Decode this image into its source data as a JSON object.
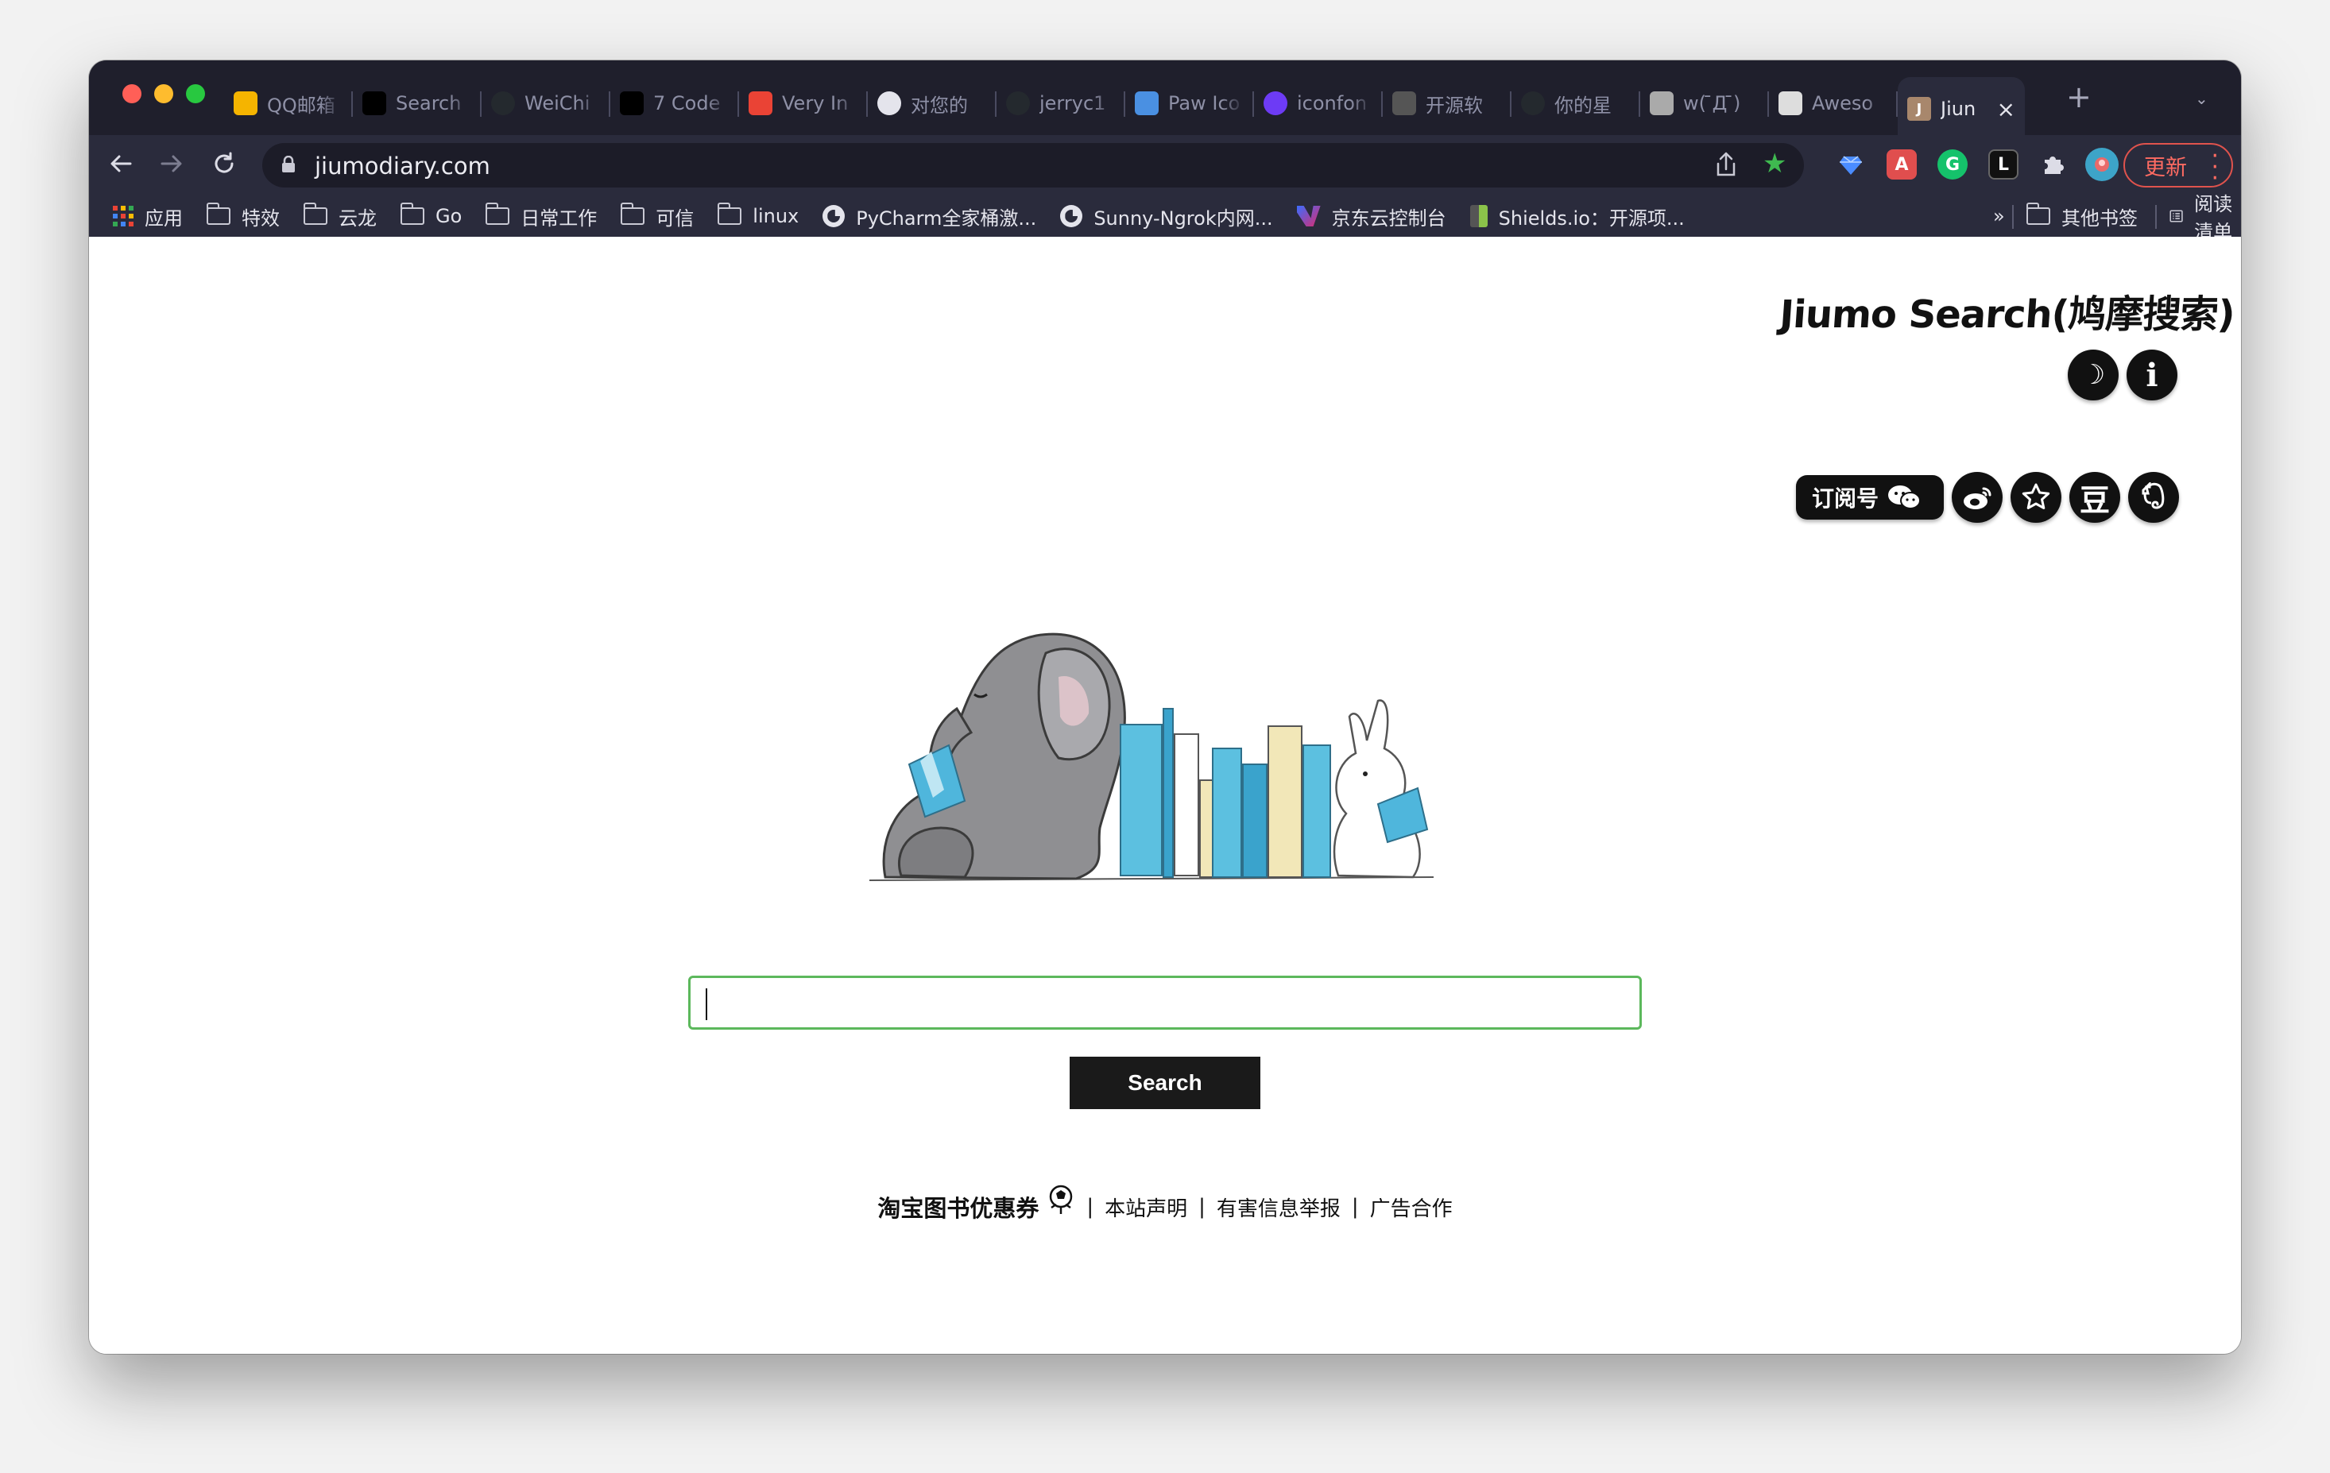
{
  "tabs": [
    {
      "label": "QQ邮箱",
      "icon": "qq-mail-icon",
      "color": "#f5b400"
    },
    {
      "label": "Search",
      "icon": "medium-icon",
      "color": "#000000"
    },
    {
      "label": "WeiChi",
      "icon": "github-icon",
      "color": "#24292e"
    },
    {
      "label": "7 Code",
      "icon": "medium-icon",
      "color": "#000000"
    },
    {
      "label": "Very In",
      "icon": "gmail-icon",
      "color": "#ea4335"
    },
    {
      "label": "对您的",
      "icon": "globe-icon",
      "color": "#e4e4ec"
    },
    {
      "label": "jerryc1",
      "icon": "github-icon",
      "color": "#24292e"
    },
    {
      "label": "Paw Ico",
      "icon": "flag-icon",
      "color": "#4a90e2"
    },
    {
      "label": "iconfon",
      "icon": "iconfont-icon",
      "color": "#6d3bf5"
    },
    {
      "label": "开源软",
      "icon": "oschina-icon",
      "color": "#555555"
    },
    {
      "label": "你的星",
      "icon": "github-icon",
      "color": "#24292e"
    },
    {
      "label": "w( ̄Д ̄)",
      "icon": "sun-icon",
      "color": "#aaaaaa"
    },
    {
      "label": "Aweso",
      "icon": "awesome-icon",
      "color": "#dddddd"
    },
    {
      "label": "Jiun",
      "icon": "jiumo-icon",
      "color": "#a8876c",
      "letter": "J"
    }
  ],
  "address": {
    "url": "jiumodiary.com"
  },
  "update_label": "更新",
  "bookmarks": [
    {
      "label": "应用",
      "icon": "apps-grid-icon"
    },
    {
      "label": "特效",
      "icon": "folder-icon"
    },
    {
      "label": "云龙",
      "icon": "folder-icon"
    },
    {
      "label": "Go",
      "icon": "folder-icon"
    },
    {
      "label": "日常工作",
      "icon": "folder-icon"
    },
    {
      "label": "可信",
      "icon": "folder-icon"
    },
    {
      "label": "linux",
      "icon": "folder-icon"
    },
    {
      "label": "PyCharm全家桶激...",
      "icon": "globe-icon"
    },
    {
      "label": "Sunny-Ngrok内网...",
      "icon": "globe-icon"
    },
    {
      "label": "京东云控制台",
      "icon": "jdcloud-icon"
    },
    {
      "label": "Shields.io：开源项...",
      "icon": "shields-icon"
    }
  ],
  "bookmarks_overflow": "»",
  "other_bookmarks": "其他书签",
  "reading_list": "阅读清单",
  "site": {
    "brand": "Jiumo Search(鸠摩搜索)",
    "subscribe_label": "订阅号",
    "douban_glyph": "豆",
    "search_placeholder": "",
    "search_button": "Search",
    "footer": {
      "coupon": "淘宝图书优惠券",
      "statement": "本站声明",
      "report": "有害信息举报",
      "ads": "广告合作",
      "sep": "|"
    }
  },
  "colors": {
    "accent_green": "#5cb85c",
    "update_red": "#e0534d",
    "chrome_bg": "#2a2b3c"
  }
}
